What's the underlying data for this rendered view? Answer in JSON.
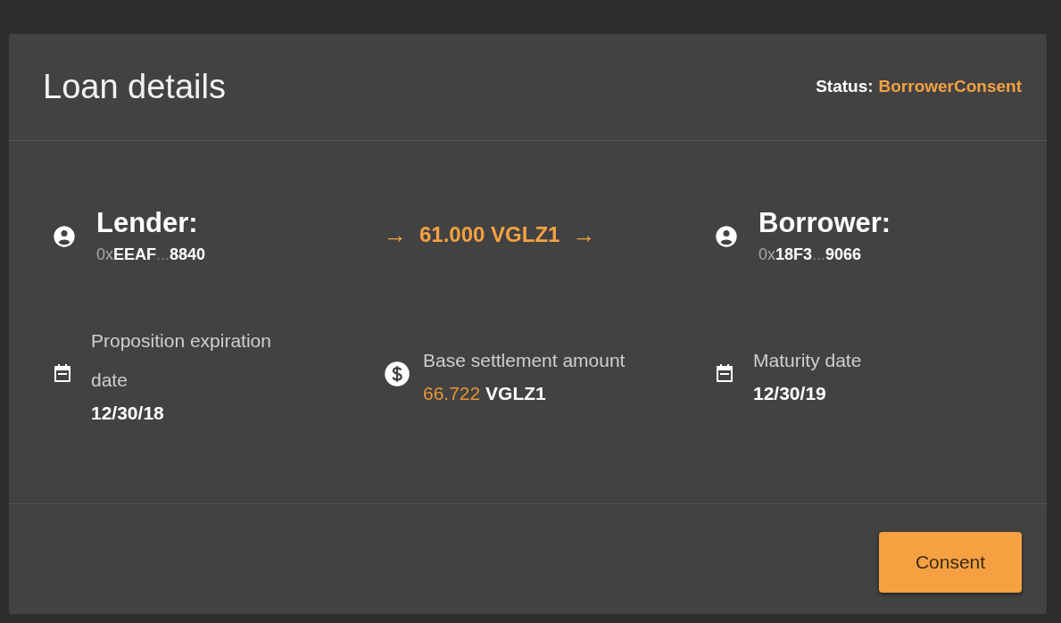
{
  "card": {
    "title": "Loan details",
    "status_label": "Status:",
    "status_value": "BorrowerConsent"
  },
  "lender": {
    "kind": "person",
    "label": "Lender:",
    "address": {
      "prefix": "0x",
      "head": "EEAF",
      "ellipsis": "...",
      "tail": "8840"
    }
  },
  "transfer": {
    "left_arrow": "→",
    "amount": "61.000 VGLZ1",
    "right_arrow": "→"
  },
  "borrower": {
    "kind": "person",
    "label": "Borrower:",
    "address": {
      "prefix": "0x",
      "head": "18F3",
      "ellipsis": "...",
      "tail": "9066"
    }
  },
  "details": [
    {
      "kind": "calendar",
      "label": "Proposition expiration date",
      "value": "12/30/18"
    },
    {
      "kind": "dollar",
      "label": "Base settlement amount",
      "amount": "66.722",
      "unit": "VGLZ1"
    },
    {
      "kind": "calendar",
      "label": "Maturity date",
      "value": "12/30/19"
    }
  ],
  "actions": [
    {
      "label": "Consent"
    }
  ]
}
